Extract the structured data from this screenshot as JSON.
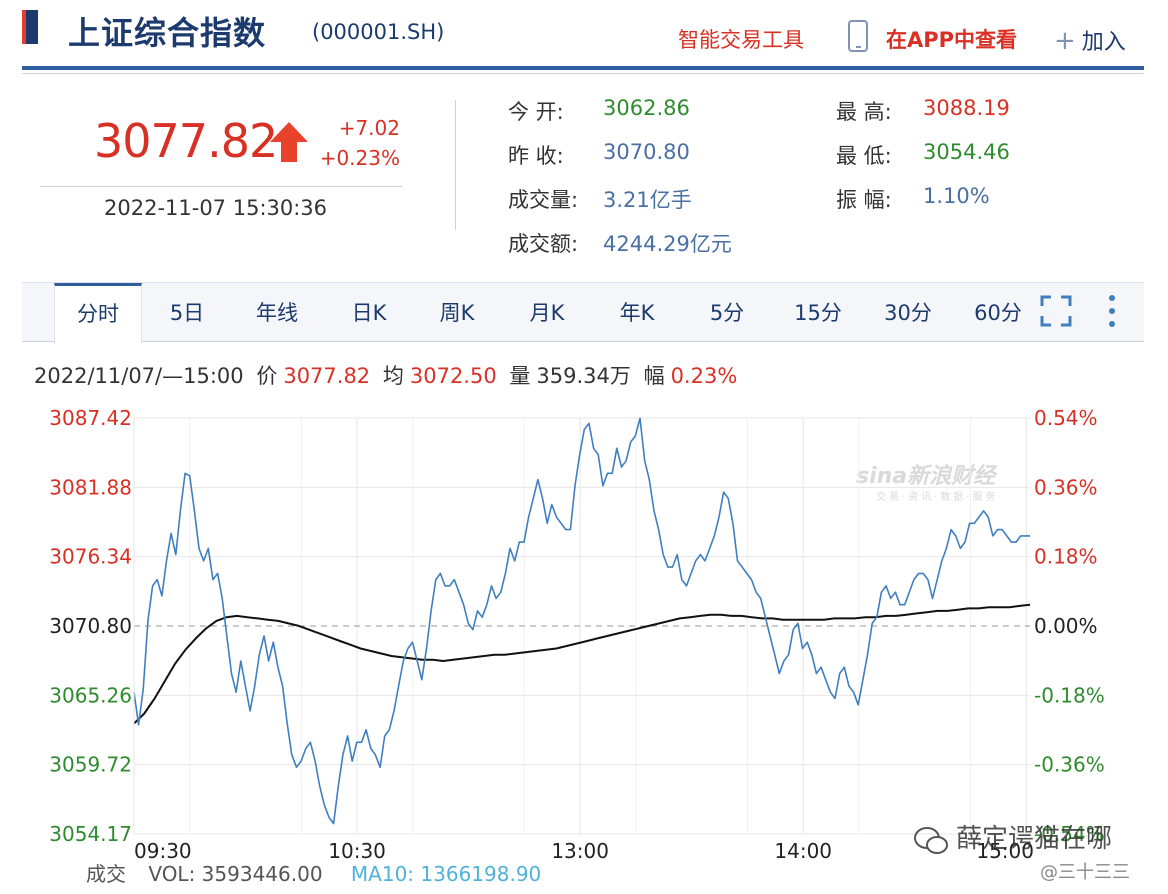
{
  "header": {
    "index_name": "上证综合指数",
    "index_code": "(000001.SH)",
    "tool_link": "智能交易工具",
    "app_link": "在APP中查看",
    "add_label": "加入"
  },
  "quote": {
    "price": "3077.82",
    "change": "+7.02",
    "change_pct": "+0.23%",
    "datetime": "2022-11-07 15:30:36",
    "stats": [
      {
        "label": "今  开:",
        "value": "3062.86",
        "color": "green"
      },
      {
        "label": "昨  收:",
        "value": "3070.80",
        "color": "blue"
      },
      {
        "label": "成交量:",
        "value": "3.21亿手",
        "color": "blue"
      },
      {
        "label": "成交额:",
        "value": "4244.29亿元",
        "color": "blue"
      },
      {
        "label": "最  高:",
        "value": "3088.19",
        "color": "red"
      },
      {
        "label": "最  低:",
        "value": "3054.46",
        "color": "green"
      },
      {
        "label": "振  幅:",
        "value": "1.10%",
        "color": "blue"
      }
    ]
  },
  "tabs": [
    "分时",
    "5日",
    "年线",
    "日K",
    "周K",
    "月K",
    "年K",
    "5分",
    "15分",
    "30分",
    "60分"
  ],
  "info": {
    "time": "2022/11/07/—15:00",
    "price_label": "价",
    "price": "3077.82",
    "avg_label": "均",
    "avg": "3072.50",
    "vol_label": "量",
    "vol": "359.34万",
    "amp_label": "幅",
    "amp": "0.23%"
  },
  "volume": {
    "label": "成交",
    "vol": "VOL: 3593446.00",
    "ma": "MA10: 1366198.90"
  },
  "watermark": {
    "logo": "sina新浪财经",
    "sub": "交易·资讯·数据·服务",
    "wechat": "薛定谔猫在哪",
    "wechat_sub": "@三十三三"
  },
  "chart_data": {
    "type": "line",
    "prev_close": 3070.8,
    "ylim": [
      3054.17,
      3087.42
    ],
    "y_ticks_left": [
      "3087.42",
      "3081.88",
      "3076.34",
      "3070.80",
      "3065.26",
      "3059.72",
      "3054.17"
    ],
    "y_ticks_right": [
      "0.54%",
      "0.36%",
      "0.18%",
      "0.00%",
      "-0.18%",
      "-0.36%",
      "-0.54%"
    ],
    "x_ticks": [
      "09:30",
      "10:30",
      "13:00",
      "14:00",
      "15:00"
    ],
    "colors": {
      "price": "#3f7fbf",
      "avg": "#111111",
      "up": "#d93025",
      "down": "#2e8b2e"
    },
    "series": [
      {
        "name": "价",
        "values": [
          3065.5,
          3062.9,
          3065.8,
          3071.2,
          3074.0,
          3074.5,
          3073.2,
          3076.0,
          3078.2,
          3076.5,
          3080.0,
          3083.0,
          3082.8,
          3080.0,
          3077.0,
          3076.0,
          3077.0,
          3074.5,
          3075.0,
          3073.0,
          3070.0,
          3067.0,
          3065.5,
          3068.0,
          3066.0,
          3064.0,
          3066.0,
          3068.5,
          3070.0,
          3068.0,
          3069.5,
          3067.5,
          3066.0,
          3063.0,
          3060.5,
          3059.5,
          3060.0,
          3061.0,
          3061.5,
          3060.0,
          3058.0,
          3056.5,
          3055.5,
          3055.0,
          3058.0,
          3060.5,
          3062.0,
          3060.0,
          3061.5,
          3061.5,
          3062.5,
          3061.0,
          3060.5,
          3059.5,
          3062.0,
          3062.5,
          3064.0,
          3066.0,
          3068.0,
          3069.0,
          3069.5,
          3068.0,
          3066.5,
          3069.0,
          3072.0,
          3074.5,
          3075.0,
          3074.0,
          3074.0,
          3074.5,
          3073.5,
          3072.5,
          3071.0,
          3070.5,
          3072.0,
          3071.5,
          3072.5,
          3074.0,
          3073.0,
          3073.5,
          3075.0,
          3077.0,
          3076.0,
          3077.5,
          3077.5,
          3079.5,
          3081.0,
          3082.5,
          3081.0,
          3079.0,
          3080.5,
          3079.5,
          3079.0,
          3078.5,
          3078.5,
          3082.0,
          3084.5,
          3086.5,
          3087.0,
          3085.0,
          3084.5,
          3082.0,
          3083.0,
          3083.0,
          3085.0,
          3083.5,
          3084.0,
          3085.5,
          3086.0,
          3087.4,
          3084.0,
          3082.5,
          3080.0,
          3078.5,
          3076.5,
          3075.5,
          3075.5,
          3076.5,
          3074.5,
          3074.0,
          3075.0,
          3076.0,
          3076.5,
          3076.0,
          3077.0,
          3078.0,
          3079.5,
          3081.5,
          3081.0,
          3079.0,
          3076.0,
          3075.5,
          3075.0,
          3074.5,
          3073.5,
          3073.0,
          3071.5,
          3070.0,
          3068.5,
          3067.0,
          3068.0,
          3068.5,
          3070.5,
          3071.0,
          3069.0,
          3069.5,
          3068.5,
          3067.0,
          3067.5,
          3066.5,
          3065.5,
          3065.0,
          3067.0,
          3067.5,
          3066.0,
          3065.5,
          3064.5,
          3066.5,
          3068.5,
          3071.0,
          3071.5,
          3073.5,
          3074.0,
          3073.0,
          3073.5,
          3072.5,
          3072.5,
          3073.5,
          3074.5,
          3075.0,
          3075.0,
          3074.5,
          3073.0,
          3074.5,
          3076.0,
          3077.0,
          3078.5,
          3078.0,
          3077.0,
          3077.5,
          3079.0,
          3079.0,
          3079.5,
          3080.0,
          3079.5,
          3078.0,
          3078.5,
          3078.5,
          3078.0,
          3077.5,
          3077.5,
          3078.0,
          3078.0,
          3078.0
        ]
      },
      {
        "name": "均",
        "values": [
          3063.0,
          3063.8,
          3065.0,
          3066.4,
          3067.8,
          3068.9,
          3069.8,
          3070.6,
          3071.2,
          3071.5,
          3071.6,
          3071.5,
          3071.4,
          3071.3,
          3071.2,
          3071.0,
          3070.8,
          3070.5,
          3070.2,
          3069.9,
          3069.6,
          3069.3,
          3069.0,
          3068.8,
          3068.6,
          3068.4,
          3068.3,
          3068.2,
          3068.1,
          3068.1,
          3068.0,
          3068.1,
          3068.2,
          3068.3,
          3068.4,
          3068.5,
          3068.5,
          3068.6,
          3068.7,
          3068.8,
          3068.9,
          3069.0,
          3069.2,
          3069.4,
          3069.6,
          3069.8,
          3070.0,
          3070.2,
          3070.4,
          3070.6,
          3070.8,
          3071.0,
          3071.2,
          3071.4,
          3071.5,
          3071.6,
          3071.7,
          3071.7,
          3071.6,
          3071.6,
          3071.5,
          3071.4,
          3071.4,
          3071.3,
          3071.3,
          3071.3,
          3071.3,
          3071.3,
          3071.4,
          3071.4,
          3071.4,
          3071.5,
          3071.5,
          3071.6,
          3071.6,
          3071.7,
          3071.8,
          3071.9,
          3072.0,
          3072.0,
          3072.1,
          3072.2,
          3072.2,
          3072.3,
          3072.3,
          3072.3,
          3072.4,
          3072.5
        ]
      }
    ],
    "xlabel": "",
    "ylabel": "",
    "grid": true
  }
}
